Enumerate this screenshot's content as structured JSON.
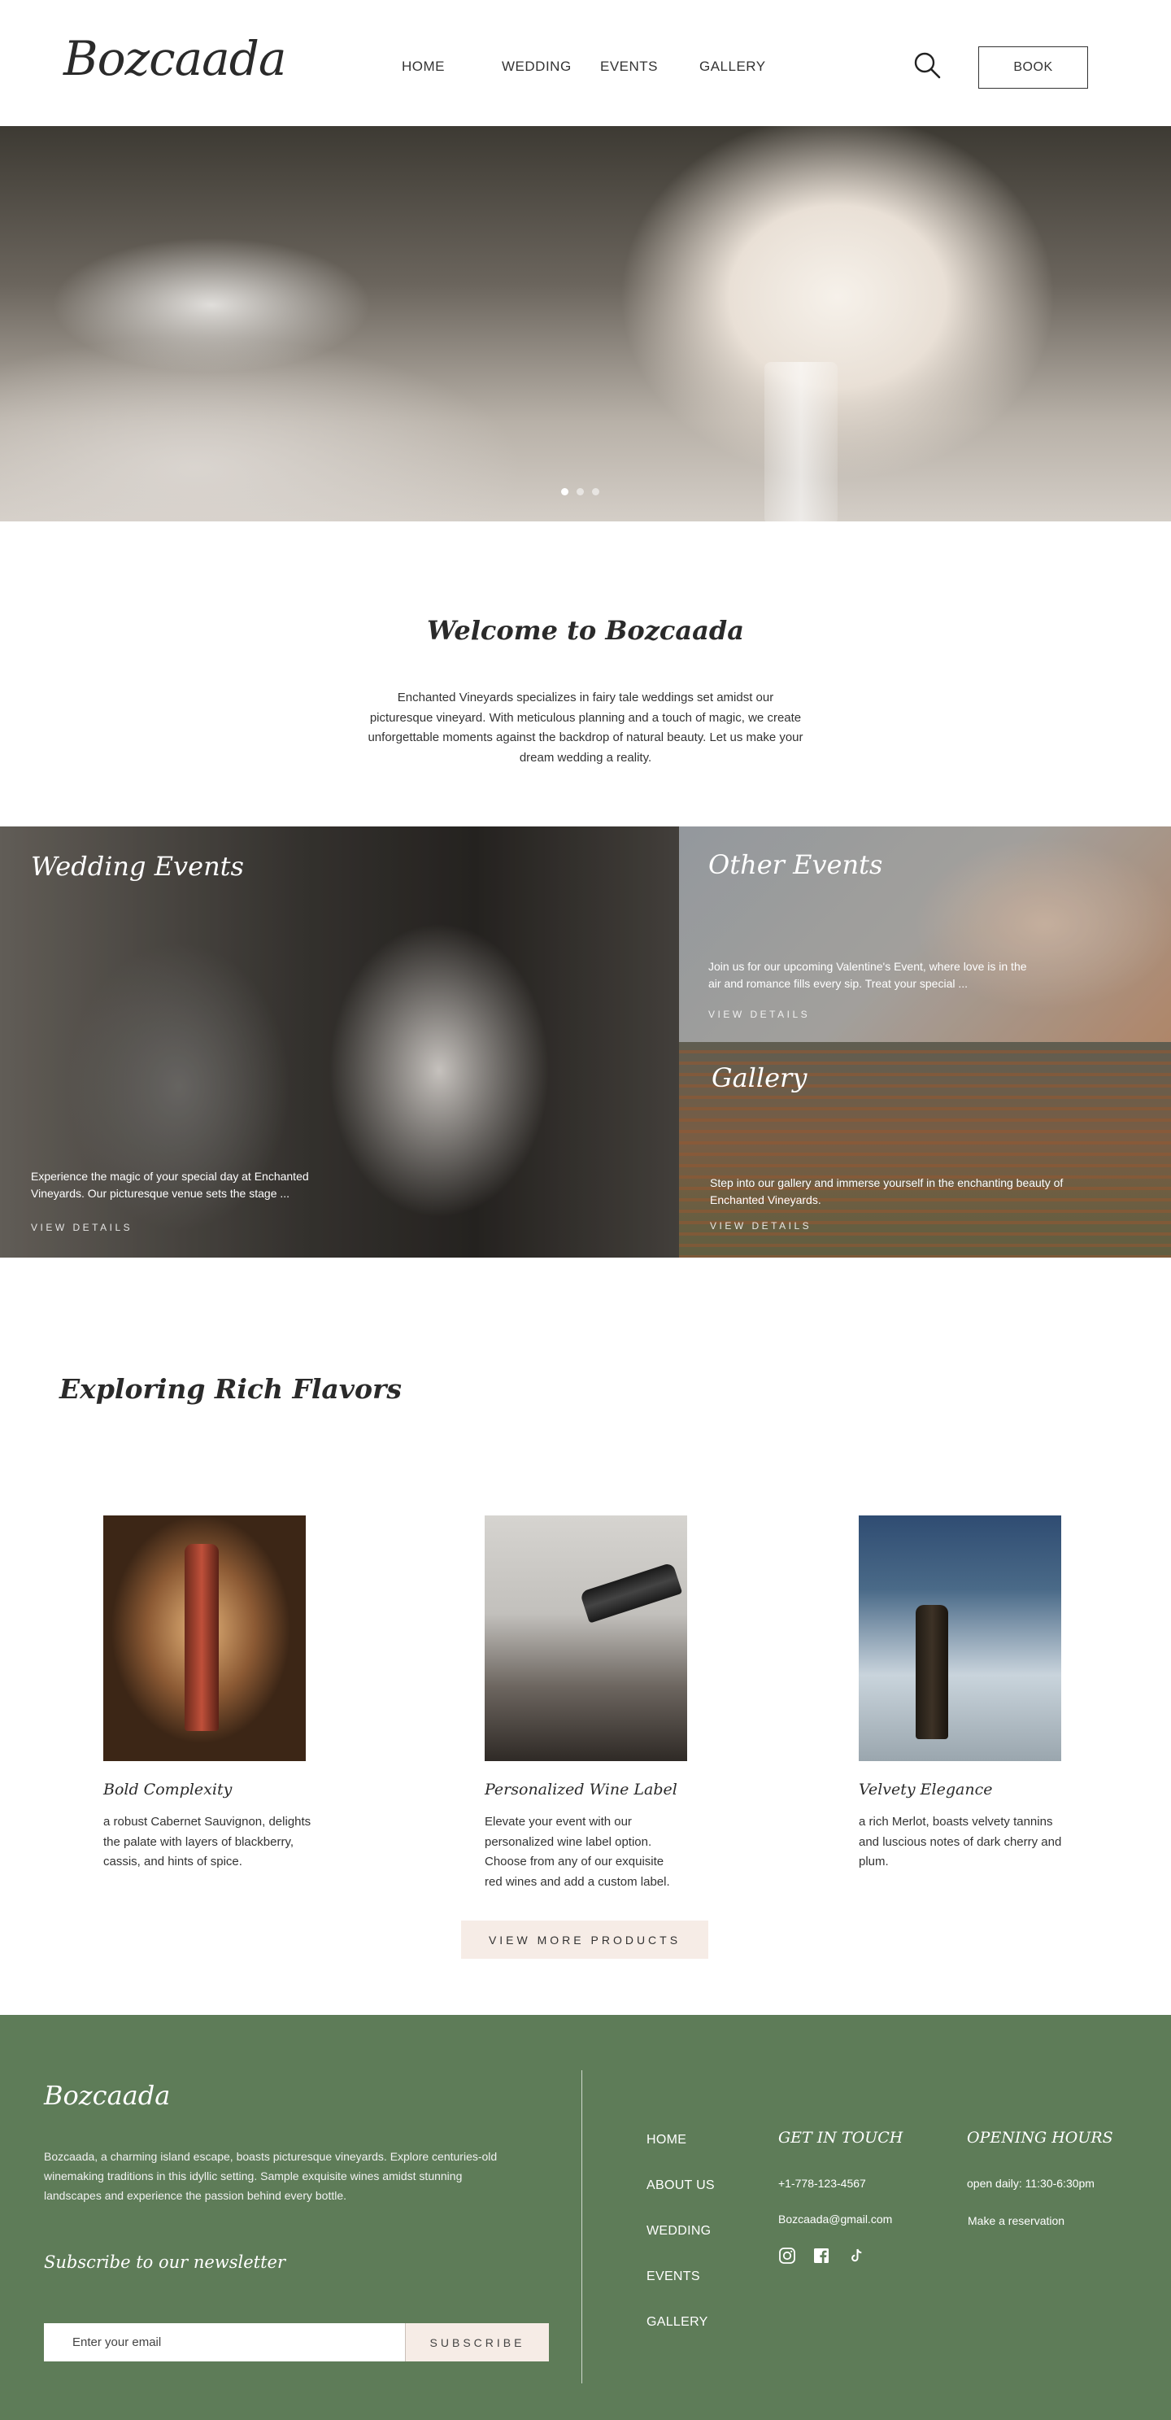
{
  "header": {
    "logo": "Bozcaada",
    "nav": [
      "HOME",
      "WEDDING",
      "EVENTS",
      "GALLERY"
    ],
    "book_label": "BOOK"
  },
  "hero": {
    "slide_count": 3,
    "active_slide": 1
  },
  "welcome": {
    "title": "Welcome to Bozcaada",
    "text": "Enchanted Vineyards specializes in fairy tale weddings set amidst our picturesque vineyard. With meticulous planning and a touch of magic, we create unforgettable moments against the backdrop of natural beauty. Let us make your dream wedding a reality."
  },
  "cards": [
    {
      "title": "Wedding Events",
      "desc": "Experience the magic of your special day at Enchanted Vineyards. Our picturesque venue sets the stage ...",
      "link": "VIEW DETAILS"
    },
    {
      "title": "Other Events",
      "desc": "Join us for our upcoming Valentine's Event, where love is in the air and romance fills every sip. Treat your special ...",
      "link": "VIEW DETAILS"
    },
    {
      "title": "Gallery",
      "desc": "Step into our gallery and immerse yourself in the enchanting beauty of Enchanted Vineyards.",
      "link": "VIEW DETAILS"
    }
  ],
  "flavors": {
    "title": "Exploring Rich Flavors",
    "products": [
      {
        "title": "Bold Complexity",
        "desc": "a robust Cabernet Sauvignon, delights the palate with layers of blackberry, cassis, and hints of spice."
      },
      {
        "title": "Personalized Wine Label",
        "desc": "Elevate your event with our personalized wine label option. Choose from any of our exquisite red wines and add a custom label."
      },
      {
        "title": "Velvety Elegance",
        "desc": "a rich Merlot, boasts velvety tannins and luscious notes of dark cherry and plum."
      }
    ],
    "view_more": "VIEW MORE PRODUCTS"
  },
  "footer": {
    "logo": "Bozcaada",
    "about": "Bozcaada, a charming island escape, boasts picturesque vineyards. Explore centuries-old winemaking traditions in this idyllic setting. Sample exquisite wines amidst stunning landscapes and experience the passion behind every bottle.",
    "newsletter_title": "Subscribe to our newsletter",
    "email_placeholder": "Enter your email",
    "subscribe_label": "SUBSCRIBE",
    "nav": [
      "HOME",
      "ABOUT US",
      "WEDDING",
      "EVENTS",
      "GALLERY"
    ],
    "contact_title": "GET IN TOUCH",
    "phone": "+1-778-123-4567",
    "email": "Bozcaada@gmail.com",
    "social_icons": [
      "instagram-icon",
      "facebook-icon",
      "tiktok-icon"
    ],
    "hours_title": "OPENING HOURS",
    "hours": "open daily: 11:30-6:30pm",
    "reservation": "Make a reservation"
  },
  "colors": {
    "footer_bg": "#5e7c58",
    "button_bg": "#f6ece6",
    "text_dark": "#2a2a2a"
  }
}
